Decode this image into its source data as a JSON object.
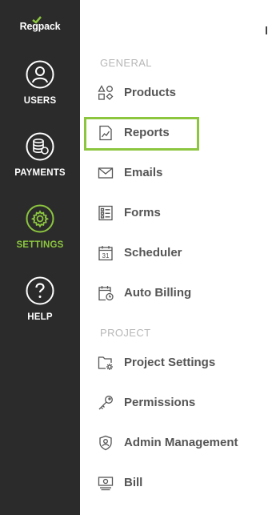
{
  "brand": {
    "logo_text": "Regpack",
    "accent": "#8cc63f"
  },
  "rail": {
    "items": [
      {
        "label": "USERS",
        "icon": "user-icon"
      },
      {
        "label": "PAYMENTS",
        "icon": "coins-icon"
      },
      {
        "label": "SETTINGS",
        "icon": "gear-icon",
        "active": true
      },
      {
        "label": "HELP",
        "icon": "question-icon"
      }
    ]
  },
  "menu": {
    "general_heading": "GENERAL",
    "general_items": [
      {
        "label": "Products",
        "icon": "shapes-icon"
      },
      {
        "label": "Reports",
        "icon": "chart-icon",
        "highlighted": true
      },
      {
        "label": "Emails",
        "icon": "envelope-icon"
      },
      {
        "label": "Forms",
        "icon": "form-icon"
      },
      {
        "label": "Scheduler",
        "icon": "calendar-icon",
        "calendar_day": "31"
      },
      {
        "label": "Auto Billing",
        "icon": "calendar-clock-icon"
      }
    ],
    "project_heading": "PROJECT",
    "project_items": [
      {
        "label": "Project Settings",
        "icon": "folder-gear-icon"
      },
      {
        "label": "Permissions",
        "icon": "key-icon"
      },
      {
        "label": "Admin Management",
        "icon": "shield-user-icon"
      },
      {
        "label": "Bill",
        "icon": "bill-icon"
      }
    ]
  }
}
